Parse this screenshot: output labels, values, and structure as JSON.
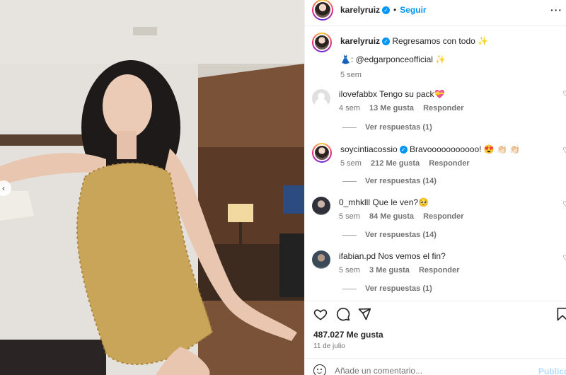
{
  "post": {
    "image_alt": "Photo post",
    "nav_prev_icon": "chevron-left-icon"
  },
  "header": {
    "username": "karelyruiz",
    "separator": "•",
    "follow_label": "Seguir",
    "more_label": "···"
  },
  "caption": {
    "username": "karelyruiz",
    "text_line1": "Regresamos con todo ✨",
    "text_line2": "👗: @edgarponceofficial ✨",
    "time": "5 sem"
  },
  "comments": [
    {
      "username": "ilovefabbx",
      "text": "Tengo su pack💝",
      "time": "4 sem",
      "likes": "13 Me gusta",
      "reply": "Responder",
      "replies": "Ver respuestas (1)"
    },
    {
      "username": "soycintiacossio",
      "text": "Bravooooooooooo! 😍 👏🏻 👏🏻",
      "time": "5 sem",
      "likes": "212 Me gusta",
      "reply": "Responder",
      "replies": "Ver respuestas (14)"
    },
    {
      "username": "0_mhklll",
      "text": "Que le ven?🥺",
      "time": "5 sem",
      "likes": "84 Me gusta",
      "reply": "Responder",
      "replies": "Ver respuestas (14)"
    },
    {
      "username": "ifabian.pd",
      "text": "Nos vemos el fin?",
      "time": "5 sem",
      "likes": "3 Me gusta",
      "reply": "Responder",
      "replies": "Ver respuestas (1)"
    }
  ],
  "actions": {
    "icons": [
      "heart-icon",
      "comment-icon",
      "share-icon",
      "bookmark-icon"
    ]
  },
  "stats": {
    "likes": "487.027 Me gusta",
    "date": "11 de julio"
  },
  "comment_box": {
    "placeholder": "Añade un comentario...",
    "publish_label": "Publicar"
  },
  "colors": {
    "accent": "#0095f6",
    "muted": "#737373",
    "publish_disabled": "#b3dbff"
  }
}
